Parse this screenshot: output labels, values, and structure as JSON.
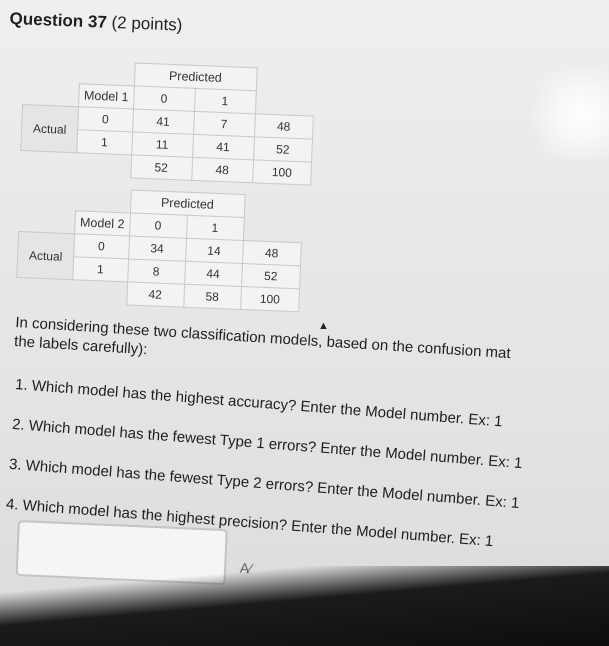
{
  "question": {
    "number": "Question 37",
    "points": "(2 points)"
  },
  "model1": {
    "predicted_label": "Predicted",
    "model_label": "Model 1",
    "actual_label": "Actual",
    "class0": "0",
    "class1": "1",
    "row0": [
      "41",
      "7",
      "48"
    ],
    "row1": [
      "11",
      "41",
      "52"
    ],
    "totals": [
      "52",
      "48",
      "100"
    ]
  },
  "model2": {
    "predicted_label": "Predicted",
    "model_label": "Model 2",
    "actual_label": "Actual",
    "class0": "0",
    "class1": "1",
    "row0": [
      "34",
      "14",
      "48"
    ],
    "row1": [
      "8",
      "44",
      "52"
    ],
    "totals": [
      "42",
      "58",
      "100"
    ]
  },
  "intro": {
    "line1": "In considering these two classification models, based on the confusion mat",
    "line2": "the labels carefully):"
  },
  "questions": [
    "1. Which model has the highest accuracy? Enter the Model number. Ex: 1",
    "2. Which model has the fewest Type 1 errors? Enter the Model number. Ex: 1",
    "3. Which model has the fewest Type 2 errors? Enter the Model number. Ex: 1",
    "4. Which model has the highest precision? Enter the Model number. Ex: 1"
  ],
  "answer": {
    "value": ""
  },
  "icons": {
    "spellcheck": "spellcheck-icon",
    "cursor": "mouse-cursor-icon"
  }
}
